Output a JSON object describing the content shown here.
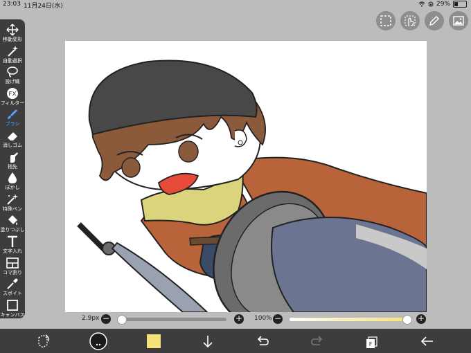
{
  "status": {
    "time": "23:03",
    "date": "11月24日(水)",
    "battery": "29%",
    "battery_level": 0.29
  },
  "tools": [
    {
      "name": "move-tool",
      "label": "移動変形",
      "icon": "move-arrows-icon"
    },
    {
      "name": "auto-select-tool",
      "label": "自動選択",
      "icon": "magic-wand-icon"
    },
    {
      "name": "lasso-tool",
      "label": "投げ縄",
      "icon": "lasso-icon"
    },
    {
      "name": "filter-tool",
      "label": "フィルター",
      "icon": "fx-icon"
    },
    {
      "name": "brush-tool",
      "label": "ブラシ",
      "icon": "brush-icon",
      "active": true
    },
    {
      "name": "eraser-tool",
      "label": "消しゴム",
      "icon": "eraser-icon"
    },
    {
      "name": "finger-tool",
      "label": "指先",
      "icon": "finger-icon"
    },
    {
      "name": "blur-tool",
      "label": "ぼかし",
      "icon": "droplet-icon"
    },
    {
      "name": "special-pen-tool",
      "label": "特殊ペン",
      "icon": "sparkle-pen-icon"
    },
    {
      "name": "fill-tool",
      "label": "塗りつぶし",
      "icon": "bucket-icon"
    },
    {
      "name": "text-tool",
      "label": "文字入れ",
      "icon": "text-t-icon"
    },
    {
      "name": "frame-tool",
      "label": "コマ割り",
      "icon": "frame-icon"
    },
    {
      "name": "eyedropper-tool",
      "label": "スポイト",
      "icon": "eyedropper-icon"
    },
    {
      "name": "canvas-tool",
      "label": "キャンバス",
      "icon": "canvas-square-icon"
    }
  ],
  "top_buttons": [
    "selection-icon",
    "hand-touch-icon",
    "pen-icon",
    "image-icon"
  ],
  "brush": {
    "size_label": "2.9px",
    "size_level": 0.02
  },
  "opacity": {
    "label": "100%",
    "level": 1.0
  },
  "bottom": {
    "primary_color": "#1a1a1a",
    "secondary_color": "#f6e27a",
    "icons": [
      "rotate-icon",
      "color-circle-icon",
      "color-swatch-icon",
      "arrow-down-icon",
      "undo-icon",
      "redo-icon",
      "layers-icon",
      "back-arrow-icon"
    ]
  },
  "colors": {
    "toolbar_bg": "#3d3d3d",
    "accent": "#4fa6ff",
    "opacity_track": "#f6e27a"
  }
}
